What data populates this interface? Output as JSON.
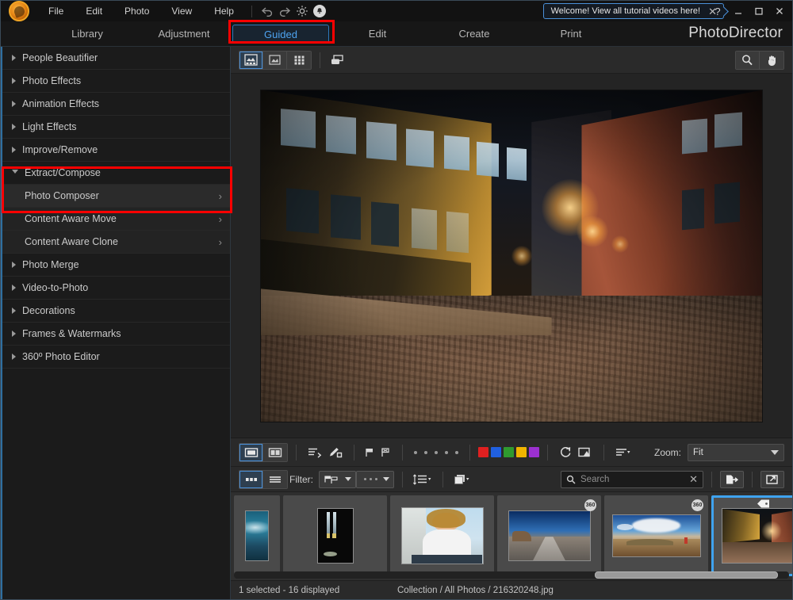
{
  "app": {
    "brand": "PhotoDirector"
  },
  "menubar": {
    "logo_icon": "cyberlink-logo-icon",
    "items": [
      "File",
      "Edit",
      "Photo",
      "View",
      "Help"
    ],
    "undo_icon": "undo-icon",
    "redo_icon": "redo-icon",
    "settings_icon": "gear-icon",
    "notifications_icon": "bell-icon",
    "tooltip": {
      "text": "Welcome! View all tutorial videos here!",
      "close_icon": "close-icon"
    },
    "help_label": "?",
    "minimize_label": "—",
    "maximize_label": "☐",
    "close_label": "✕"
  },
  "tabs": [
    {
      "label": "Library",
      "active": false
    },
    {
      "label": "Adjustment",
      "active": false
    },
    {
      "label": "Guided",
      "active": true
    },
    {
      "label": "Edit",
      "active": false
    },
    {
      "label": "Create",
      "active": false
    },
    {
      "label": "Print",
      "active": false
    }
  ],
  "sidebar": {
    "items": [
      {
        "label": "People Beautifier",
        "type": "group",
        "expanded": false
      },
      {
        "label": "Photo Effects",
        "type": "group",
        "expanded": false
      },
      {
        "label": "Animation Effects",
        "type": "group",
        "expanded": false
      },
      {
        "label": "Light Effects",
        "type": "group",
        "expanded": false
      },
      {
        "label": "Improve/Remove",
        "type": "group",
        "expanded": false
      },
      {
        "label": "Extract/Compose",
        "type": "group",
        "expanded": true
      },
      {
        "label": "Photo Composer",
        "type": "sub",
        "current": true
      },
      {
        "label": "Content Aware Move",
        "type": "sub",
        "current": false
      },
      {
        "label": "Content Aware Clone",
        "type": "sub",
        "current": false
      },
      {
        "label": "Photo Merge",
        "type": "group",
        "expanded": false
      },
      {
        "label": "Video-to-Photo",
        "type": "group",
        "expanded": false
      },
      {
        "label": "Decorations",
        "type": "group",
        "expanded": false
      },
      {
        "label": "Frames & Watermarks",
        "type": "group",
        "expanded": false
      },
      {
        "label": "360º Photo Editor",
        "type": "group",
        "expanded": false
      }
    ]
  },
  "viewer_toolbar": {
    "view_single_icon": "view-single-photo-icon",
    "view_compare_icon": "view-compare-icon",
    "view_grid_icon": "view-grid-icon",
    "duplicate_icon": "duplicate-layers-icon",
    "zoom_tool_icon": "magnifier-icon",
    "hand_tool_icon": "hand-tool-icon"
  },
  "strip_toolbar": {
    "single_view_icon": "single-view-icon",
    "split_view_icon": "split-view-icon",
    "sort_icon": "sort-order-icon",
    "edit_tag_icon": "pencil-tag-icon",
    "flag_icon": "flag-icon",
    "reject_icon": "reject-flag-icon",
    "rating_dots": 5,
    "color_labels": [
      "#e02020",
      "#2060e0",
      "#2f9a2f",
      "#f0b400",
      "#9b30d0"
    ],
    "rotate_icon": "rotate-right-icon",
    "slideshow_icon": "slideshow-icon",
    "sort_menu_icon": "sort-menu-icon",
    "zoom_label": "Zoom:",
    "zoom_value": "Fit"
  },
  "filterbar": {
    "thumb_view_icon": "thumbnail-view-icon",
    "list_view_icon": "list-view-icon",
    "filter_label": "Filter:",
    "flag_filter_icon": "flag-filter-icon",
    "rating_filter_icon": "rating-filter-icon",
    "sort_size_icon": "sort-size-icon",
    "stack_icon": "stack-icon",
    "search": {
      "placeholder": "Search",
      "value": "",
      "search_icon": "search-icon",
      "clear_icon": "clear-icon"
    },
    "export_icon": "export-icon",
    "open_external_icon": "open-external-icon"
  },
  "filmstrip": {
    "items": [
      {
        "name": "wave-photo",
        "badge": "",
        "selected": false,
        "tag": false
      },
      {
        "name": "dark-window-photo",
        "badge": "",
        "selected": false,
        "tag": false
      },
      {
        "name": "portrait-woman-photo",
        "badge": "",
        "selected": false,
        "tag": false
      },
      {
        "name": "desert-road-360-photo",
        "badge": "360",
        "selected": false,
        "tag": false
      },
      {
        "name": "canyon-panorama-360-photo",
        "badge": "360",
        "selected": false,
        "tag": false
      },
      {
        "name": "night-street-photo",
        "badge": "",
        "selected": true,
        "tag": true
      }
    ],
    "scrollbar_position_percent": 65
  },
  "statusbar": {
    "selection": "1 selected - 16 displayed",
    "breadcrumb": "Collection / All Photos / 216320248.jpg"
  },
  "annotations": {
    "highlight_color": "#ff0000",
    "boxes": [
      "guided-tab-highlight",
      "extract-compose-photo-composer-highlight"
    ]
  }
}
